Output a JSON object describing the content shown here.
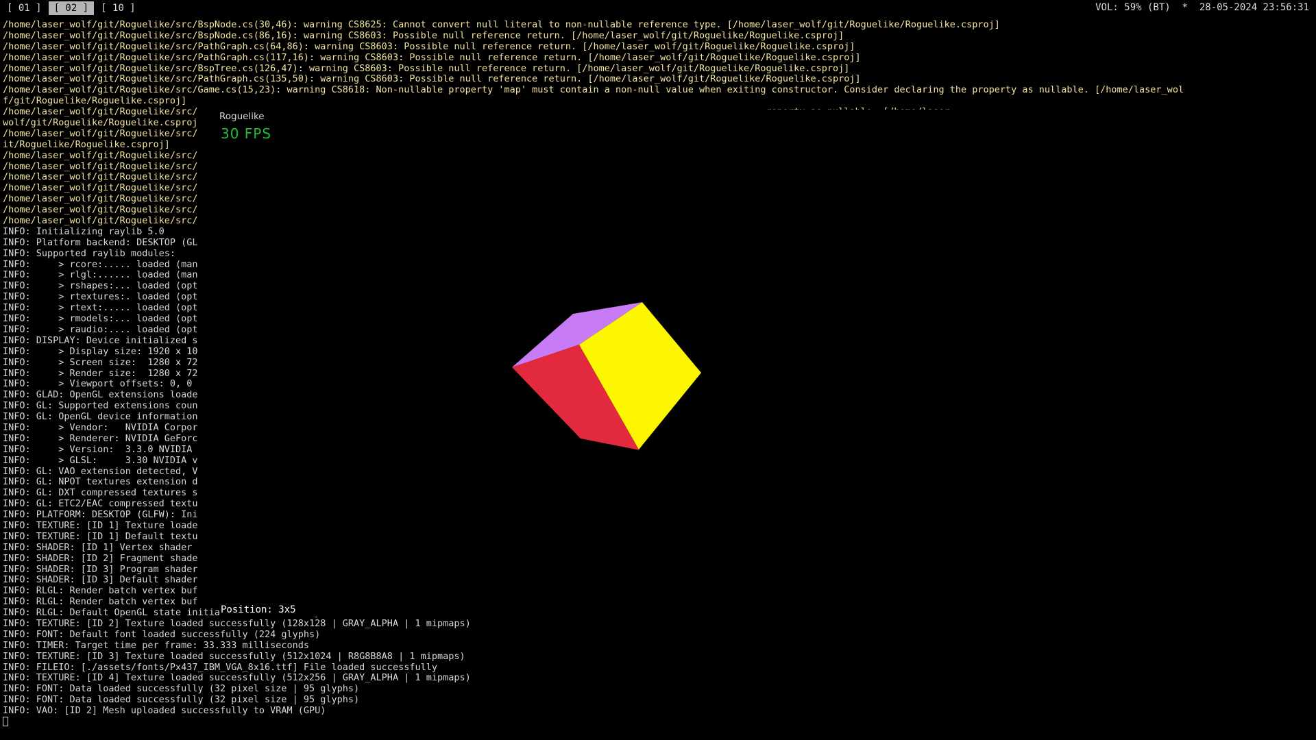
{
  "topbar": {
    "workspaces": [
      "[ 01 ]",
      "[ 02 ]",
      "[ 10 ]"
    ],
    "active_workspace": 1,
    "status": "VOL: 59% (BT)  *  28-05-2024 23:56:31"
  },
  "terminal": {
    "warnings": [
      "/home/laser_wolf/git/Roguelike/src/BspNode.cs(30,46): warning CS8625: Cannot convert null literal to non-nullable reference type. [/home/laser_wolf/git/Roguelike/Roguelike.csproj]",
      "/home/laser_wolf/git/Roguelike/src/BspNode.cs(86,16): warning CS8603: Possible null reference return. [/home/laser_wolf/git/Roguelike/Roguelike.csproj]",
      "/home/laser_wolf/git/Roguelike/src/PathGraph.cs(64,86): warning CS8603: Possible null reference return. [/home/laser_wolf/git/Roguelike/Roguelike.csproj]",
      "/home/laser_wolf/git/Roguelike/src/PathGraph.cs(117,16): warning CS8603: Possible null reference return. [/home/laser_wolf/git/Roguelike/Roguelike.csproj]",
      "/home/laser_wolf/git/Roguelike/src/BspTree.cs(126,47): warning CS8603: Possible null reference return. [/home/laser_wolf/git/Roguelike/Roguelike.csproj]",
      "/home/laser_wolf/git/Roguelike/src/PathGraph.cs(135,50): warning CS8603: Possible null reference return. [/home/laser_wolf/git/Roguelike/Roguelike.csproj]",
      "/home/laser_wolf/git/Roguelike/src/Game.cs(15,23): warning CS8618: Non-nullable property 'map' must contain a non-null value when exiting constructor. Consider declaring the property as nullable. [/home/laser_wol",
      "f/git/Roguelike/Roguelike.csproj]",
      "/home/laser_wolf/git/Roguelike/src/                                                                                                      roperty as nullable. [/home/laser_",
      "wolf/git/Roguelike/Roguelike.csproj                                                                                                      ",
      "/home/laser_wolf/git/Roguelike/src/                                                                                                      d as nullable. [/home/laser_wolf/g",
      "it/Roguelike/Roguelike.csproj]",
      "/home/laser_wolf/git/Roguelike/src/",
      "/home/laser_wolf/git/Roguelike/src/",
      "/home/laser_wolf/git/Roguelike/src/",
      "/home/laser_wolf/git/Roguelike/src/                                                                                                      oguelike.csproj]",
      "/home/laser_wolf/git/Roguelike/src/                                                                                                      oguelike.csproj]",
      "/home/laser_wolf/git/Roguelike/src/",
      "/home/laser_wolf/git/Roguelike/src/"
    ],
    "info": [
      "INFO: Initializing raylib 5.0",
      "INFO: Platform backend: DESKTOP (GL",
      "INFO: Supported raylib modules:",
      "INFO:     > rcore:..... loaded (man",
      "INFO:     > rlgl:...... loaded (man",
      "INFO:     > rshapes:... loaded (opt",
      "INFO:     > rtextures:. loaded (opt",
      "INFO:     > rtext:..... loaded (opt",
      "INFO:     > rmodels:... loaded (opt",
      "INFO:     > raudio:.... loaded (opt",
      "INFO: DISPLAY: Device initialized s",
      "INFO:     > Display size: 1920 x 10",
      "INFO:     > Screen size:  1280 x 72",
      "INFO:     > Render size:  1280 x 72",
      "INFO:     > Viewport offsets: 0, 0",
      "INFO: GLAD: OpenGL extensions loade",
      "INFO: GL: Supported extensions coun",
      "INFO: GL: OpenGL device information",
      "INFO:     > Vendor:   NVIDIA Corpor",
      "INFO:     > Renderer: NVIDIA GeForc",
      "INFO:     > Version:  3.3.0 NVIDIA",
      "INFO:     > GLSL:     3.30 NVIDIA v",
      "INFO: GL: VAO extension detected, V",
      "INFO: GL: NPOT textures extension d",
      "INFO: GL: DXT compressed textures s",
      "INFO: GL: ETC2/EAC compressed textu",
      "INFO: PLATFORM: DESKTOP (GLFW): Ini",
      "INFO: TEXTURE: [ID 1] Texture loade",
      "INFO: TEXTURE: [ID 1] Default textu",
      "INFO: SHADER: [ID 1] Vertex shader",
      "INFO: SHADER: [ID 2] Fragment shade",
      "INFO: SHADER: [ID 3] Program shader",
      "INFO: SHADER: [ID 3] Default shader",
      "INFO: RLGL: Render batch vertex buf",
      "INFO: RLGL: Render batch vertex buf",
      "INFO: RLGL: Default OpenGL state initialized successfully",
      "INFO: TEXTURE: [ID 2] Texture loaded successfully (128x128 | GRAY_ALPHA | 1 mipmaps)",
      "INFO: FONT: Default font loaded successfully (224 glyphs)",
      "INFO: TIMER: Target time per frame: 33.333 milliseconds",
      "INFO: TEXTURE: [ID 3] Texture loaded successfully (512x1024 | R8G8B8A8 | 1 mipmaps)",
      "INFO: FILEIO: [./assets/fonts/Px437_IBM_VGA_8x16.ttf] File loaded successfully",
      "INFO: TEXTURE: [ID 4] Texture loaded successfully (512x256 | GRAY_ALPHA | 1 mipmaps)",
      "INFO: FONT: Data loaded successfully (32 pixel size | 95 glyphs)",
      "INFO: FONT: Data loaded successfully (32 pixel size | 95 glyphs)",
      "INFO: VAO: [ID 2] Mesh uploaded successfully to VRAM (GPU)"
    ]
  },
  "game_window": {
    "title": "Roguelike",
    "fps": "30 FPS",
    "position": "Position: 3x5",
    "cube_colors": {
      "front": "#fcf600",
      "top": "#c77bf5",
      "side": "#e3293d"
    }
  }
}
